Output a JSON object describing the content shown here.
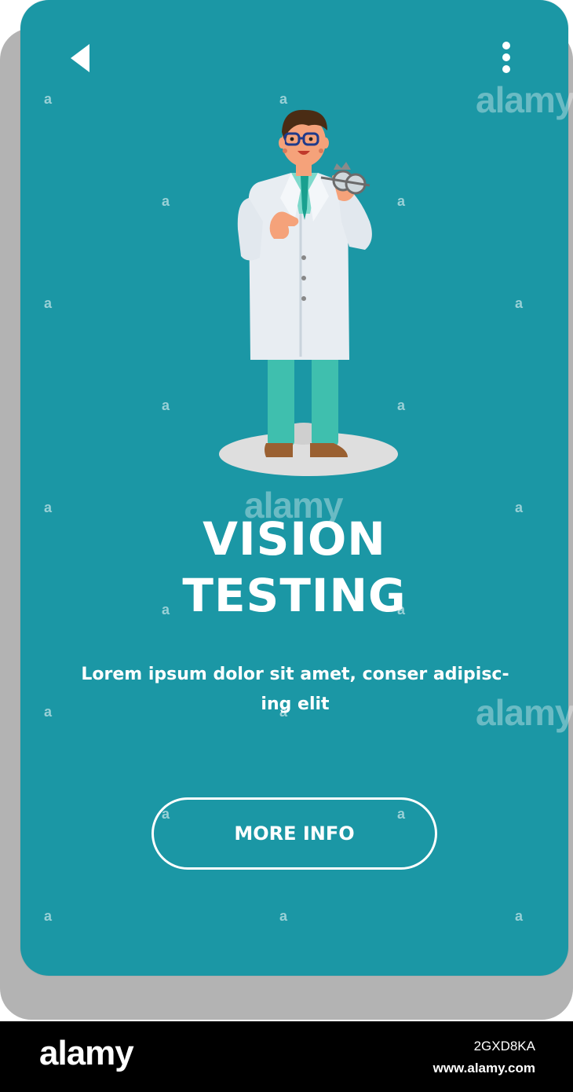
{
  "screen": {
    "title_line1": "VISION",
    "title_line2": "TESTING",
    "description_line1": "Lorem ipsum dolor sit amet, conser adipisc-",
    "description_line2": "ing elit",
    "button_label": "MORE INFO"
  },
  "nav": {
    "back_icon": "back-arrow-icon",
    "menu_icon": "kebab-menu-icon"
  },
  "watermark": {
    "word": "alamy",
    "letter": "a"
  },
  "footer": {
    "logo": "alamy",
    "image_id": "2GXD8KA",
    "url": "www.alamy.com"
  },
  "colors": {
    "card": "#1b97a5",
    "card_shadow": "#b3b3b3",
    "text": "#ffffff",
    "footer_bg": "#000000"
  }
}
